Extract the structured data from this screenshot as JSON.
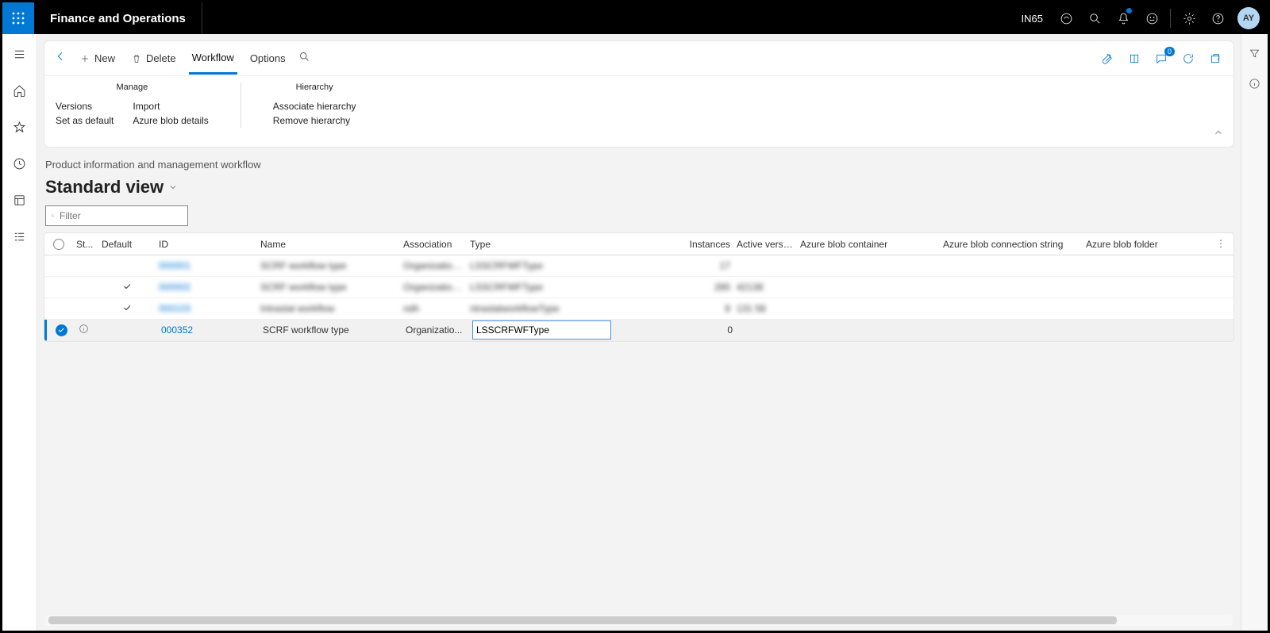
{
  "header": {
    "app_title": "Finance and Operations",
    "legal_entity": "IN65",
    "avatar": "AY",
    "notification_badge": "0"
  },
  "action_bar": {
    "new_label": "New",
    "delete_label": "Delete",
    "tabs": [
      "Workflow",
      "Options"
    ],
    "active_tab": "Workflow",
    "groups": {
      "manage": {
        "title": "Manage",
        "col1": [
          "Versions",
          "Set as default"
        ],
        "col2": [
          "Import",
          "Azure blob details"
        ]
      },
      "hierarchy": {
        "title": "Hierarchy",
        "items": [
          "Associate hierarchy",
          "Remove hierarchy"
        ]
      }
    }
  },
  "page": {
    "breadcrumb": "Product information and management workflow",
    "view_title": "Standard view",
    "filter_placeholder": "Filter"
  },
  "grid": {
    "columns": [
      "St...",
      "Default",
      "ID",
      "Name",
      "Association",
      "Type",
      "Instances",
      "Active version",
      "Azure blob container",
      "Azure blob connection string",
      "Azure blob folder"
    ],
    "rows": [
      {
        "selected": false,
        "default": false,
        "id": "000001",
        "name": "SCRF workflow type",
        "association": "Organizatio…",
        "type": "LSSCRFWFType",
        "instances": "17",
        "active_version": "",
        "blurred": true
      },
      {
        "selected": false,
        "default": true,
        "id": "000002",
        "name": "SCRF workflow type",
        "association": "Organizatio…",
        "type": "LSSCRFWFType",
        "instances": "285",
        "active_version": "42138",
        "blurred": true
      },
      {
        "selected": false,
        "default": true,
        "id": "000103",
        "name": "Intrastat workflow",
        "association": "ndh",
        "type": "ntrastatworkflowType",
        "instances": "8",
        "active_version": "131 58",
        "blurred": true
      },
      {
        "selected": true,
        "default": false,
        "id": "000352",
        "name": "SCRF workflow type",
        "association": "Organizatio...",
        "type": "LSSCRFWFType",
        "instances": "0",
        "active_version": "",
        "blurred": false,
        "status": "info"
      }
    ]
  }
}
